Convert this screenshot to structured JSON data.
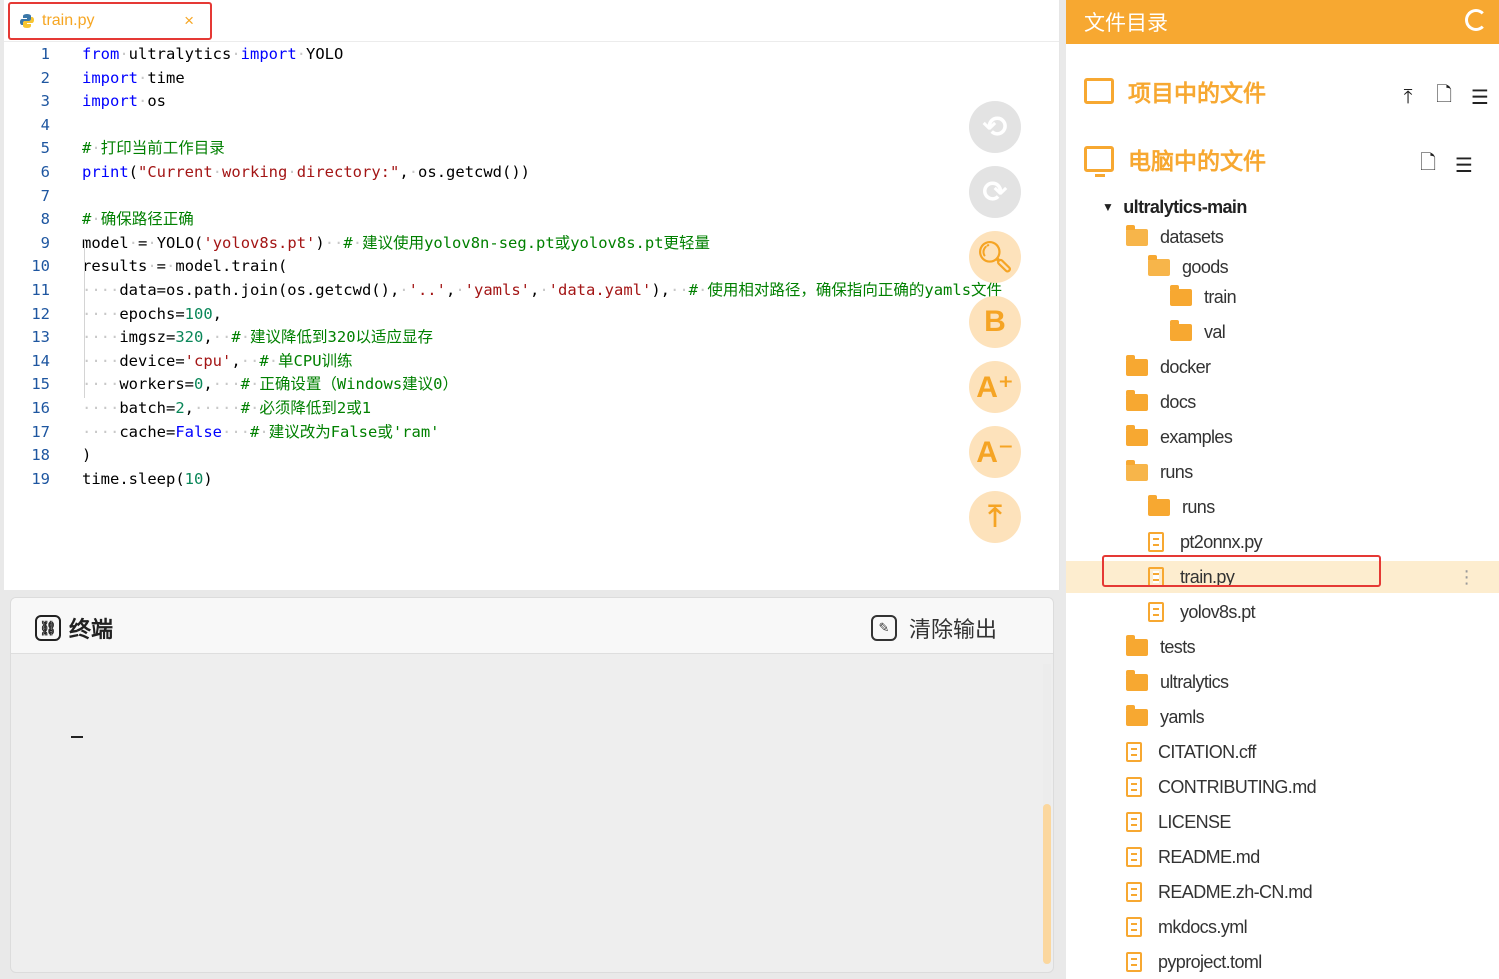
{
  "tab": {
    "filename": "train.py",
    "close": "×"
  },
  "code": [
    {
      "n": "1",
      "html": "<span class='kw'>from</span><span class='ws'>·</span>ultralytics<span class='ws'>·</span><span class='kw'>import</span><span class='ws'>·</span>YOLO"
    },
    {
      "n": "2",
      "html": "<span class='kw'>import</span><span class='ws'>·</span>time"
    },
    {
      "n": "3",
      "html": "<span class='kw'>import</span><span class='ws'>·</span>os"
    },
    {
      "n": "4",
      "html": ""
    },
    {
      "n": "5",
      "html": "<span class='cm'>#<span class='ws'>·</span>打印当前工作目录</span>"
    },
    {
      "n": "6",
      "html": "<span class='kw'>print</span>(<span class='str'>\"Current<span class='ws'>·</span>working<span class='ws'>·</span>directory:\"</span>,<span class='ws'>·</span>os.getcwd())"
    },
    {
      "n": "7",
      "html": ""
    },
    {
      "n": "8",
      "html": "<span class='cm'>#<span class='ws'>·</span>确保路径正确</span>"
    },
    {
      "n": "9",
      "html": "model<span class='ws'>·</span>=<span class='ws'>·</span>YOLO(<span class='str'>'yolov8s.pt'</span>)<span class='ws'>··</span><span class='cm'>#<span class='ws'>·</span>建议使用yolov8n-seg.pt或yolov8s.pt更轻量</span>"
    },
    {
      "n": "10",
      "html": "results<span class='ws'>·</span>=<span class='ws'>·</span>model.train("
    },
    {
      "n": "11",
      "html": "<span class='ws'>····</span>data=os.path.join(os.getcwd(),<span class='ws'>·</span><span class='str'>'..'</span>,<span class='ws'>·</span><span class='str'>'yamls'</span>,<span class='ws'>·</span><span class='str'>'data.yaml'</span>),<span class='ws'>··</span><span class='cm'>#<span class='ws'>·</span>使用相对路径，确保指向正确的yamls文件</span>"
    },
    {
      "n": "12",
      "html": "<span class='ws'>····</span>epochs=<span class='num'>100</span>,"
    },
    {
      "n": "13",
      "html": "<span class='ws'>····</span>imgsz=<span class='num'>320</span>,<span class='ws'>··</span><span class='cm'>#<span class='ws'>·</span>建议降低到320以适应显存</span>"
    },
    {
      "n": "14",
      "html": "<span class='ws'>····</span>device=<span class='str'>'cpu'</span>,<span class='ws'>··</span><span class='cm'>#<span class='ws'>·</span>单CPU训练</span>"
    },
    {
      "n": "15",
      "html": "<span class='ws'>····</span>workers=<span class='num'>0</span>,<span class='ws'>···</span><span class='cm'>#<span class='ws'>·</span>正确设置（Windows建议0）</span>"
    },
    {
      "n": "16",
      "html": "<span class='ws'>····</span>batch=<span class='num'>2</span>,<span class='ws'>·····</span><span class='cm'>#<span class='ws'>·</span>必须降低到2或1</span>"
    },
    {
      "n": "17",
      "html": "<span class='ws'>····</span>cache=<span class='kw'>False</span><span class='ws'>···</span><span class='cm'>#<span class='ws'>·</span>建议改为False或'ram'</span>"
    },
    {
      "n": "18",
      "html": ")"
    },
    {
      "n": "19",
      "html": "time.sleep(<span class='num'>10</span>)"
    }
  ],
  "floating_buttons": [
    {
      "name": "undo-button",
      "glyph": "⟲",
      "style": "grey"
    },
    {
      "name": "redo-button",
      "glyph": "⟳",
      "style": "grey"
    },
    {
      "name": "search-button",
      "glyph": "🔍︎",
      "style": "or"
    },
    {
      "name": "bold-button",
      "glyph": "B",
      "style": "or"
    },
    {
      "name": "font-increase-button",
      "glyph": "A⁺",
      "style": "or"
    },
    {
      "name": "font-decrease-button",
      "glyph": "A⁻",
      "style": "or"
    },
    {
      "name": "scroll-top-button",
      "glyph": "⤒",
      "style": "or"
    }
  ],
  "terminal": {
    "title": "终端",
    "clear_label": "清除输出",
    "prompt": "_"
  },
  "panel": {
    "title": "文件目录",
    "project_files": "项目中的文件",
    "computer_files": "电脑中的文件",
    "tree": [
      {
        "label": "ultralytics-main",
        "type": "root",
        "indent": 0
      },
      {
        "label": "datasets",
        "type": "folder-open",
        "indent": 1
      },
      {
        "label": "goods",
        "type": "folder-open",
        "indent": 2
      },
      {
        "label": "train",
        "type": "folder",
        "indent": 3
      },
      {
        "label": "val",
        "type": "folder",
        "indent": 3
      },
      {
        "label": "docker",
        "type": "folder",
        "indent": 1
      },
      {
        "label": "docs",
        "type": "folder",
        "indent": 1
      },
      {
        "label": "examples",
        "type": "folder",
        "indent": 1
      },
      {
        "label": "runs",
        "type": "folder-open",
        "indent": 1
      },
      {
        "label": "runs",
        "type": "folder",
        "indent": 2
      },
      {
        "label": "pt2onnx.py",
        "type": "file",
        "indent": 2
      },
      {
        "label": "train.py",
        "type": "file",
        "indent": 2,
        "selected": true
      },
      {
        "label": "yolov8s.pt",
        "type": "file",
        "indent": 2
      },
      {
        "label": "tests",
        "type": "folder",
        "indent": 1
      },
      {
        "label": "ultralytics",
        "type": "folder",
        "indent": 1
      },
      {
        "label": "yamls",
        "type": "folder",
        "indent": 1
      },
      {
        "label": "CITATION.cff",
        "type": "file",
        "indent": 1
      },
      {
        "label": "CONTRIBUTING.md",
        "type": "file",
        "indent": 1
      },
      {
        "label": "LICENSE",
        "type": "file",
        "indent": 1
      },
      {
        "label": "README.md",
        "type": "file",
        "indent": 1
      },
      {
        "label": "README.zh-CN.md",
        "type": "file",
        "indent": 1
      },
      {
        "label": "mkdocs.yml",
        "type": "file",
        "indent": 1
      },
      {
        "label": "pyproject.toml",
        "type": "file",
        "indent": 1
      }
    ]
  },
  "colors": {
    "accent": "#f7a831",
    "highlight_border": "#e53935",
    "selected_row": "#fdedcf"
  }
}
